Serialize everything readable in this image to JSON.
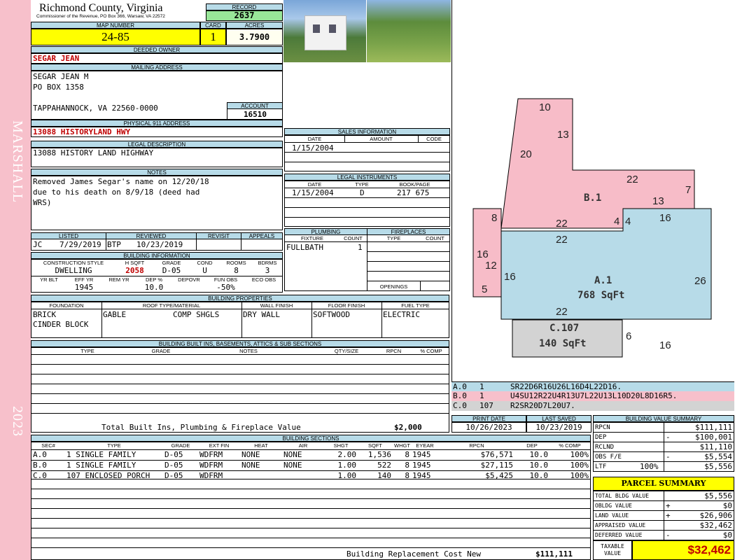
{
  "header": {
    "county": "Richmond County, Virginia",
    "commissioner": "Commissioner of the Revenue, PO Box 366, Warsaw, VA 22572"
  },
  "side": {
    "district": "MARSHALL",
    "year": "2023"
  },
  "record": {
    "label": "RECORD",
    "value": "2637"
  },
  "map": {
    "label": "MAP NUMBER",
    "value": "24-85",
    "card_label": "CARD",
    "card": "1",
    "acres_label": "ACRES",
    "acres": "3.7900"
  },
  "owner": {
    "label": "DEEDED OWNER",
    "name": "SEGAR JEAN"
  },
  "mailing": {
    "label": "MAILING ADDRESS",
    "line1": "SEGAR JEAN M",
    "line2": "PO BOX 1358",
    "line3": "TAPPAHANNOCK, VA 22560-0000",
    "account_label": "ACCOUNT",
    "account": "16510"
  },
  "physical": {
    "label": "PHYSICAL 911 ADDRESS",
    "value": "13088 HISTORYLAND HWY"
  },
  "legal": {
    "label": "LEGAL DESCRIPTION",
    "value": "13088 HISTORY LAND HIGHWAY"
  },
  "notes": {
    "label": "NOTES",
    "line1": "Removed James Segar's name on 12/20/18",
    "line2": "due to his death on 8/9/18 (deed had",
    "line3": "WRS)"
  },
  "sales": {
    "label": "SALES INFORMATION",
    "cols": [
      "DATE",
      "AMOUNT",
      "CODE"
    ],
    "date": "1/15/2004"
  },
  "instruments": {
    "label": "LEGAL INSTRUMENTS",
    "cols": [
      "DATE",
      "TYPE",
      "BOOK/PAGE"
    ],
    "date": "1/15/2004",
    "type": "D",
    "bookpage": "217 675"
  },
  "listed": {
    "listed_label": "LISTED",
    "reviewed_label": "REVIEWED",
    "revisit_label": "REVISIT",
    "appeals_label": "APPEALS",
    "listed_by": "JC",
    "listed_date": "7/29/2019",
    "reviewed_by": "BTP",
    "reviewed_date": "10/23/2019"
  },
  "building_info": {
    "label": "BUILDING INFORMATION",
    "cols1": [
      "CONSTRUCTION STYLE",
      "H SQFT",
      "GRADE",
      "COND",
      "ROOMS",
      "BDRMS"
    ],
    "style": "DWELLING",
    "hsqft": "2058",
    "grade": "D-05",
    "cond": "U",
    "rooms": "8",
    "bdrms": "3",
    "cols2": [
      "YR BLT",
      "EFF YR",
      "REM YR",
      "DEP %",
      "DEPOVR",
      "FUN OBS",
      "ECO OBS"
    ],
    "eff_yr": "1945",
    "dep": "10.0",
    "fun_obs": "-50%"
  },
  "plumbing": {
    "label": "PLUMBING",
    "fixture_label": "FIXTURE",
    "count_label": "COUNT",
    "fixture": "FULLBATH",
    "count": "1"
  },
  "fireplaces": {
    "label": "FIREPLACES",
    "type_label": "TYPE",
    "count_label": "COUNT",
    "openings_label": "OPENINGS"
  },
  "properties": {
    "label": "BUILDING PROPERTIES",
    "cols": [
      "FOUNDATION",
      "ROOF TYPE/MATERIAL",
      "WALL FINISH",
      "FLOOR FINISH",
      "FUEL TYPE"
    ],
    "foundation1": "BRICK",
    "foundation2": "CINDER BLOCK",
    "roof_type": "GABLE",
    "roof_material": "COMP SHGLS",
    "wall": "DRY WALL",
    "floor": "SOFTWOOD",
    "fuel": "ELECTRIC"
  },
  "builtins": {
    "label": "BUILDING BUILT INS, BASEMENTS, ATTICS & SUB SECTIONS",
    "cols": [
      "TYPE",
      "GRADE",
      "NOTES",
      "QTY/SIZE",
      "RPCN",
      "% COMP"
    ],
    "total_label": "Total Built Ins, Plumbing & Fireplace Value",
    "total": "$2,000"
  },
  "sections": {
    "label": "BUILDING SECTIONS",
    "cols": [
      "SEC#",
      "TYPE",
      "GRADE",
      "EXT FIN",
      "HEAT",
      "AIR",
      "SHGT",
      "SQFT",
      "WHGT",
      "EYEAR",
      "RPCN",
      "DEP",
      "% COMP"
    ],
    "rows": [
      [
        "A.0",
        "1 SINGLE FAMILY",
        "D-05",
        "WDFRM",
        "NONE",
        "NONE",
        "2.00",
        "1,536",
        "8",
        "1945",
        "$76,571",
        "10.0",
        "100%"
      ],
      [
        "B.0",
        "1 SINGLE FAMILY",
        "D-05",
        "WDFRM",
        "NONE",
        "NONE",
        "1.00",
        "522",
        "8",
        "1945",
        "$27,115",
        "10.0",
        "100%"
      ],
      [
        "C.0",
        "107 ENCLOSED PORCH",
        "D-05",
        "WDFRM",
        "",
        "",
        "1.00",
        "140",
        "8",
        "1945",
        "$5,425",
        "10.0",
        "100%"
      ]
    ],
    "replacement_label": "Building Replacement Cost New",
    "replacement": "$111,111"
  },
  "sketch": {
    "B1": "B.1",
    "A1": "A.1",
    "A1_area": "768 SqFt",
    "C107": "C.107",
    "C107_area": "140 SqFt",
    "dims": [
      "10",
      "13",
      "20",
      "22",
      "7",
      "13",
      "16",
      "8",
      "22",
      "4",
      "4",
      "22",
      "16",
      "12",
      "16",
      "26",
      "5",
      "22",
      "6",
      "16"
    ]
  },
  "sketch_codes": [
    {
      "sec": "A.0",
      "n": "1",
      "code": "SR22D6R16U26L16D4L22D16.",
      "color": "#b7dbe8"
    },
    {
      "sec": "B.0",
      "n": "1",
      "code": "U4SU12R22U4R13U7L22U13L10D20L8D16R5.",
      "color": "#f7c0cb"
    },
    {
      "sec": "C.0",
      "n": "107",
      "code": "R2SR20D7L20U7.",
      "color": "#d3d3d3"
    }
  ],
  "dates": {
    "print_label": "PRINT DATE",
    "print": "10/26/2023",
    "saved_label": "LAST SAVED",
    "saved": "10/23/2019"
  },
  "value_summary": {
    "label": "BUILDING VALUE SUMMARY",
    "rows": [
      {
        "k": "RPCN",
        "s": "",
        "v": "$111,111"
      },
      {
        "k": "DEP",
        "s": "-",
        "v": "$100,001"
      },
      {
        "k": "RCLND",
        "s": "",
        "v": "$11,110"
      },
      {
        "k": "OBS F/E",
        "s": "-",
        "v": "$5,554"
      },
      {
        "k": "LTF",
        "s": "100%",
        "v": "$5,556"
      }
    ]
  },
  "parcel": {
    "label": "PARCEL SUMMARY",
    "rows": [
      {
        "k": "TOTAL BLDG VALUE",
        "s": "",
        "v": "$5,556"
      },
      {
        "k": "OBLDG VALUE",
        "s": "+",
        "v": "$0"
      },
      {
        "k": "LAND VALUE",
        "s": "+",
        "v": "$26,906"
      },
      {
        "k": "APPRAISED VALUE",
        "s": "",
        "v": "$32,462"
      },
      {
        "k": "DEFERRED VALUE",
        "s": "-",
        "v": "$0"
      }
    ],
    "taxable_label1": "TAXABLE",
    "taxable_label2": "VALUE",
    "taxable": "$32,462"
  }
}
